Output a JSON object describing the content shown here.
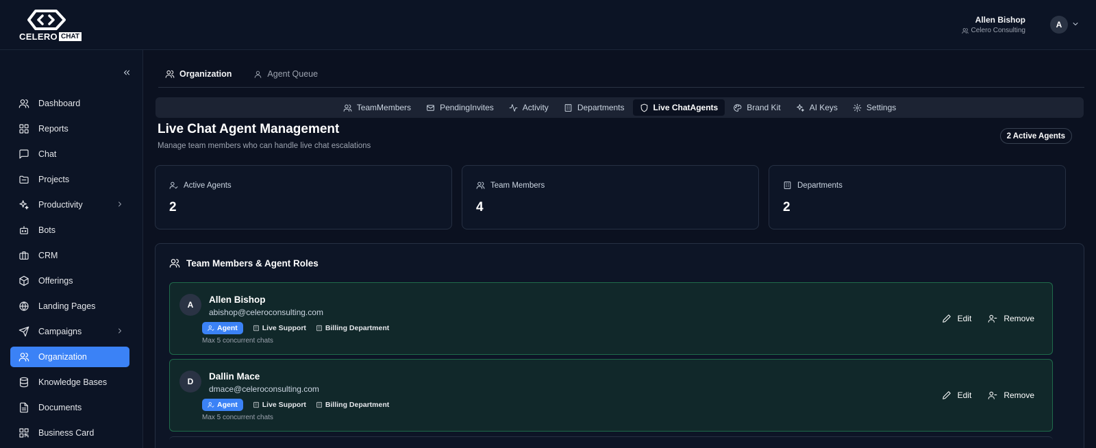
{
  "brand": {
    "name": "CELERO",
    "badge": "CHAT"
  },
  "user": {
    "name": "Allen Bishop",
    "org": "Celero Consulting",
    "initial": "A"
  },
  "sidebar": {
    "items": [
      {
        "label": "Dashboard",
        "icon": "users-icon"
      },
      {
        "label": "Reports",
        "icon": "grid-icon"
      },
      {
        "label": "Chat",
        "icon": "message-square-icon"
      },
      {
        "label": "Projects",
        "icon": "folder-icon"
      },
      {
        "label": "Productivity",
        "icon": "sparkles-icon",
        "expandable": true
      },
      {
        "label": "Bots",
        "icon": "bot-icon"
      },
      {
        "label": "CRM",
        "icon": "briefcase-icon"
      },
      {
        "label": "Offerings",
        "icon": "package-icon"
      },
      {
        "label": "Landing Pages",
        "icon": "globe-icon"
      },
      {
        "label": "Campaigns",
        "icon": "send-icon",
        "expandable": true
      },
      {
        "label": "Organization",
        "icon": "users-icon",
        "active": true
      },
      {
        "label": "Knowledge Bases",
        "icon": "database-icon"
      },
      {
        "label": "Documents",
        "icon": "file-text-icon"
      },
      {
        "label": "Business Card",
        "icon": "qr-code-icon"
      }
    ]
  },
  "top_tabs": [
    {
      "label": "Organization",
      "active": true
    },
    {
      "label": "Agent Queue",
      "active": false
    }
  ],
  "sub_tabs": [
    {
      "label": "TeamMembers",
      "icon": "users-icon"
    },
    {
      "label": "PendingInvites",
      "icon": "mail-icon"
    },
    {
      "label": "Activity",
      "icon": "activity-icon"
    },
    {
      "label": "Departments",
      "icon": "building-icon"
    },
    {
      "label": "Live ChatAgents",
      "icon": "shield-icon",
      "active": true
    },
    {
      "label": "Brand Kit",
      "icon": "palette-icon"
    },
    {
      "label": "AI Keys",
      "icon": "sparkles-icon"
    },
    {
      "label": "Settings",
      "icon": "gear-icon"
    }
  ],
  "page": {
    "title": "Live Chat Agent Management",
    "subtitle": "Manage team members who can handle live chat escalations",
    "badge": "2 Active Agents"
  },
  "stats": [
    {
      "label": "Active Agents",
      "value": "2",
      "icon": "user-check-icon"
    },
    {
      "label": "Team Members",
      "value": "4",
      "icon": "users-icon"
    },
    {
      "label": "Departments",
      "value": "2",
      "icon": "building-icon"
    }
  ],
  "members_panel": {
    "title": "Team Members & Agent Roles",
    "edit_label": "Edit",
    "remove_label": "Remove",
    "members": [
      {
        "initial": "A",
        "name": "Allen Bishop",
        "email": "abishop@celeroconsulting.com",
        "role": "Agent",
        "dept1": "Live Support",
        "dept2": "Billing Department",
        "limit": "Max 5 concurrent chats"
      },
      {
        "initial": "D",
        "name": "Dallin Mace",
        "email": "dmace@celeroconsulting.com",
        "role": "Agent",
        "dept1": "Live Support",
        "dept2": "Billing Department",
        "limit": "Max 5 concurrent chats"
      }
    ]
  },
  "colors": {
    "accent": "#3b82f6",
    "background": "#0b1120",
    "agent_card": "#11282a",
    "agent_border": "#1f6b4b"
  }
}
